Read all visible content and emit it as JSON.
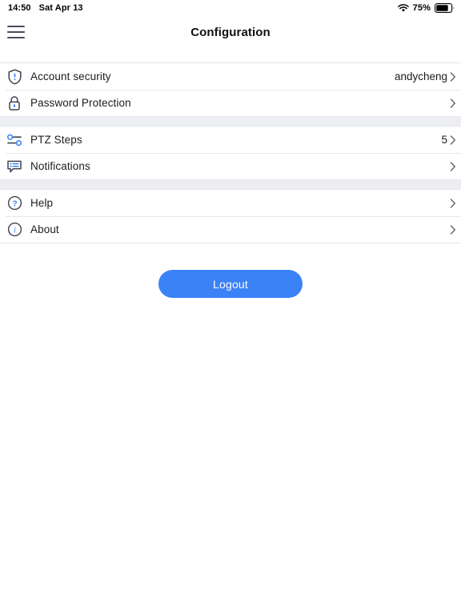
{
  "status_bar": {
    "time": "14:50",
    "date": "Sat Apr 13",
    "wifi_icon": "wifi-icon",
    "battery_percent": "75%",
    "battery_icon": "battery-icon"
  },
  "nav": {
    "menu_icon": "hamburger-menu-icon",
    "title": "Configuration"
  },
  "sections": [
    {
      "rows": [
        {
          "icon": "shield-alert-icon",
          "label": "Account security",
          "value": "andycheng",
          "chevron": "chevron-right-icon"
        },
        {
          "icon": "lock-icon",
          "label": "Password Protection",
          "value": "",
          "chevron": "chevron-right-icon"
        }
      ]
    },
    {
      "rows": [
        {
          "icon": "sliders-icon",
          "label": "PTZ Steps",
          "value": "5",
          "chevron": "chevron-right-icon"
        },
        {
          "icon": "chat-bubble-icon",
          "label": "Notifications",
          "value": "",
          "chevron": "chevron-right-icon"
        }
      ]
    },
    {
      "rows": [
        {
          "icon": "question-circle-icon",
          "label": "Help",
          "value": "",
          "chevron": "chevron-right-icon"
        },
        {
          "icon": "info-circle-icon",
          "label": "About",
          "value": "",
          "chevron": "chevron-right-icon"
        }
      ]
    }
  ],
  "logout": {
    "label": "Logout"
  },
  "colors": {
    "accent_blue": "#3b82f6",
    "icon_outline": "#3f4354",
    "separator_gray": "#eceef1",
    "hairline": "#e3e5e9",
    "text_primary": "#1c1c1e"
  }
}
